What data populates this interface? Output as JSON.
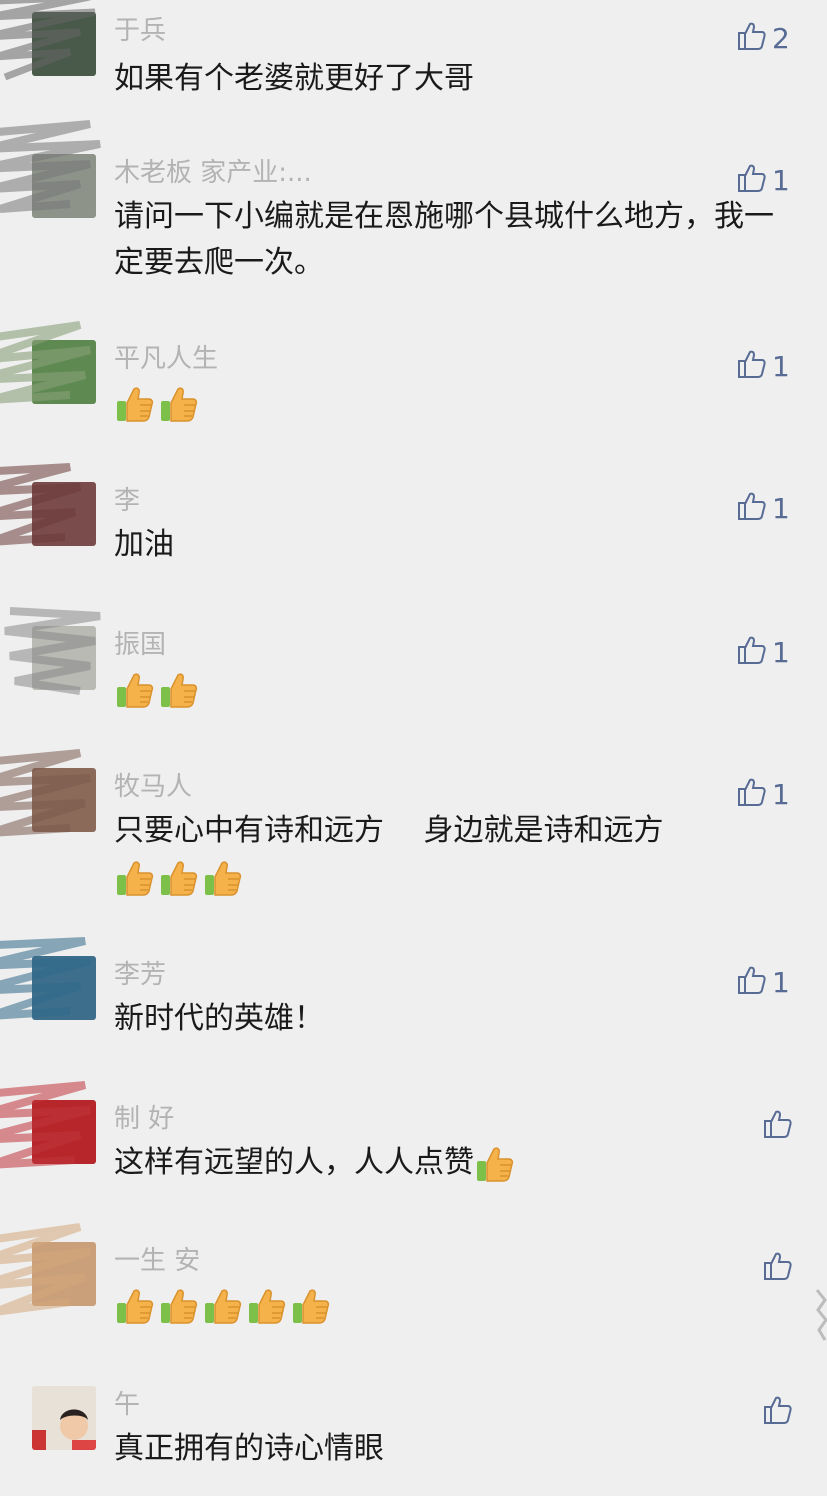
{
  "comments": [
    {
      "name": "于兵",
      "text": "如果有个老婆就更好了大哥",
      "likes": "2",
      "thumbs": 0
    },
    {
      "name": "木老板 家产业:...",
      "text": "请问一下小编就是在恩施哪个县城什么地方，我一定要去爬一次。",
      "likes": "1",
      "thumbs": 0
    },
    {
      "name": "平凡人生",
      "text": "",
      "likes": "1",
      "thumbs": 2
    },
    {
      "name": "李",
      "text": "加油",
      "likes": "1",
      "thumbs": 0
    },
    {
      "name": "振国",
      "text": "",
      "likes": "1",
      "thumbs": 2
    },
    {
      "name": "牧马人",
      "text": "只要心中有诗和远方　 身边就是诗和远方",
      "likes": "1",
      "thumbs": 3
    },
    {
      "name": "李芳",
      "text": "新时代的英雄！",
      "likes": "1",
      "thumbs": 0
    },
    {
      "name": "制 好",
      "text": "这样有远望的人，人人点赞",
      "likes": "",
      "thumbs": 1
    },
    {
      "name": "一生 安",
      "text": "",
      "likes": "",
      "thumbs": 5
    },
    {
      "name": "午",
      "text": "真正拥有的诗心情眼",
      "likes": "",
      "thumbs": 0
    }
  ],
  "icons": {
    "like": "thumbs-up-outline-icon",
    "emoji": "thumbs-up-emoji-icon"
  },
  "colors": {
    "background": "#efefef",
    "name": "#b3b3b3",
    "text": "#1a1a1a",
    "like": "#576b95",
    "thumb_emoji": "#f6b24a"
  }
}
